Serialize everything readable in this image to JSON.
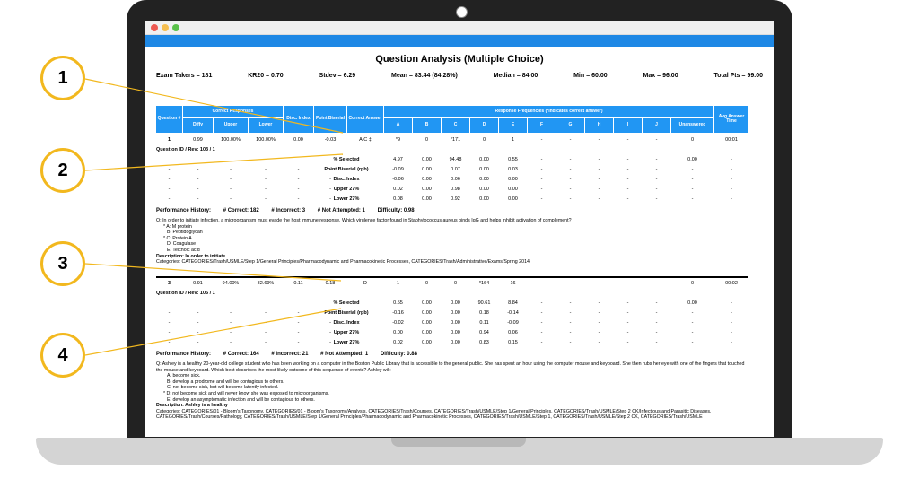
{
  "report": {
    "title": "Question Analysis (Multiple Choice)",
    "stats": {
      "exam_takers": "Exam Takers = 181",
      "kr20": "KR20 = 0.70",
      "stdev": "Stdev = 6.29",
      "mean": "Mean = 83.44 (84.28%)",
      "median": "Median = 84.00",
      "min": "Min = 60.00",
      "max": "Max = 96.00",
      "total_pts": "Total Pts = 99.00"
    },
    "headers": {
      "question": "Question #",
      "correct_responses": "Correct Responses",
      "diffy": "Diffy",
      "upper": "Upper",
      "lower": "Lower",
      "disc_index": "Disc. Index",
      "point_biserial": "Point Biserial",
      "correct_answer": "Correct Answer",
      "response_freq": "Response Frequencies (*Indicates correct answer)",
      "a": "A",
      "b": "B",
      "c": "C",
      "d": "D",
      "e": "E",
      "f": "F",
      "g": "G",
      "h": "H",
      "i": "I",
      "j": "J",
      "unanswered": "Unanswered",
      "avg_time": "Avg Answer Time"
    },
    "q1": {
      "num": "1",
      "diffy": "0.99",
      "upper": "100.00%",
      "lower": "100.00%",
      "disc": "0.00",
      "pbis": "-0.03",
      "answer": "A,C ‡",
      "freq": [
        "*9",
        "0",
        "*171",
        "0",
        "1",
        "-",
        "-",
        "-",
        "-",
        "-"
      ],
      "unanswered": "0",
      "time": "00:01",
      "id_rev": "Question ID / Rev: 103 / 1",
      "sub_rows": [
        {
          "label": "% Selected",
          "vals": [
            "4.97",
            "0.00",
            "94.48",
            "0.00",
            "0.55",
            "-",
            "-",
            "-",
            "-",
            "-",
            "0.00",
            "-"
          ]
        },
        {
          "label": "Point Biserial (rpb)",
          "vals": [
            "-0.09",
            "0.00",
            "0.07",
            "0.00",
            "0.03",
            "-",
            "-",
            "-",
            "-",
            "-",
            "-",
            "-"
          ]
        },
        {
          "label": "Disc. Index",
          "vals": [
            "-0.06",
            "0.00",
            "0.06",
            "0.00",
            "0.00",
            "-",
            "-",
            "-",
            "-",
            "-",
            "-",
            "-"
          ]
        },
        {
          "label": "Upper 27%",
          "vals": [
            "0.02",
            "0.00",
            "0.98",
            "0.00",
            "0.00",
            "-",
            "-",
            "-",
            "-",
            "-",
            "-",
            "-"
          ]
        },
        {
          "label": "Lower 27%",
          "vals": [
            "0.08",
            "0.00",
            "0.92",
            "0.00",
            "0.00",
            "-",
            "-",
            "-",
            "-",
            "-",
            "-",
            "-"
          ]
        }
      ],
      "performance": "Performance History:",
      "correct": "# Correct: 182",
      "incorrect": "# Incorrect: 3",
      "not_attempted": "# Not Attempted: 1",
      "difficulty": "Difficulty: 0.98",
      "question_text": "Q: In order to initiate infection, a microorganism must evade the host immune response. Which virulence factor found in Staphylococcus aureus binds IgG and helps inhibit activation of complement?",
      "options": [
        "* A: M protein",
        "B: Peptidoglycan",
        "* C: Protein A",
        "D: Coagulase",
        "E: Teichoic acid"
      ],
      "description": "Description: In order to initiate",
      "categories": "Categories: CATEGORIES/Trash/USMLE/Step 1/General Principles/Pharmacodynamic and Pharmacokinetic Processes, CATEGORIES/Trash/Administrative/Exams/Spring 2014"
    },
    "q3": {
      "num": "3",
      "diffy": "0.91",
      "upper": "94.00%",
      "lower": "82.69%",
      "disc": "0.11",
      "pbis": "0.18",
      "answer": "D",
      "freq": [
        "1",
        "0",
        "0",
        "*164",
        "16",
        "-",
        "-",
        "-",
        "-",
        "-"
      ],
      "unanswered": "0",
      "time": "00:02",
      "id_rev": "Question ID / Rev: 105 / 1",
      "sub_rows": [
        {
          "label": "% Selected",
          "vals": [
            "0.55",
            "0.00",
            "0.00",
            "90.61",
            "8.84",
            "-",
            "-",
            "-",
            "-",
            "-",
            "0.00",
            "-"
          ]
        },
        {
          "label": "Point Biserial (rpb)",
          "vals": [
            "-0.16",
            "0.00",
            "0.00",
            "0.18",
            "-0.14",
            "-",
            "-",
            "-",
            "-",
            "-",
            "-",
            "-"
          ]
        },
        {
          "label": "Disc. Index",
          "vals": [
            "-0.02",
            "0.00",
            "0.00",
            "0.11",
            "-0.09",
            "-",
            "-",
            "-",
            "-",
            "-",
            "-",
            "-"
          ]
        },
        {
          "label": "Upper 27%",
          "vals": [
            "0.00",
            "0.00",
            "0.00",
            "0.94",
            "0.06",
            "-",
            "-",
            "-",
            "-",
            "-",
            "-",
            "-"
          ]
        },
        {
          "label": "Lower 27%",
          "vals": [
            "0.02",
            "0.00",
            "0.00",
            "0.83",
            "0.15",
            "-",
            "-",
            "-",
            "-",
            "-",
            "-",
            "-"
          ]
        }
      ],
      "performance": "Performance History:",
      "correct": "# Correct: 164",
      "incorrect": "# Incorrect: 21",
      "not_attempted": "# Not Attempted: 1",
      "difficulty": "Difficulty: 0.88",
      "question_text": "Q: Ashley is a healthy 20-year-old college student who has been working on a computer in the Boston Public Library that is accessible to the general public. She has spent an hour using the computer mouse and keyboard. She then rubs her eye with one of the fingers that touched the mouse and keyboard. Which best describes the most likely outcome of this sequence of events? Ashley will:",
      "options": [
        "A: become sick.",
        "B: develop a prodrome and will be contagious to others.",
        "C: not become sick, but will become latently infected.",
        "* D: not become sick and will never know she was exposed to microorganisms.",
        "E: develop an asymptomatic infection and will be contagious to others."
      ],
      "description": "Description: Ashley is a healthy",
      "categories": "Categories: CATEGORIES/01 - Bloom's Taxonomy, CATEGORIES/01 - Bloom's Taxonomy/Analysis, CATEGORIES/Trash/Courses, CATEGORIES/Trash/USMLE/Step 1/General Principles, CATEGORIES/Trash/USMLE/Step 2 CK/Infectious and Parasitic Diseases, CATEGORIES/Trash/Courses/Pathology, CATEGORIES/Trash/USMLE/Step 1/General Principles/Pharmacodynamic and Pharmacokinetic Processes, CATEGORIES/Trash/USMLE/Step 1, CATEGORIES/Trash/USMLE/Step 2 CK, CATEGORIES/Trash/USMLE"
    }
  },
  "callouts": [
    "1",
    "2",
    "3",
    "4"
  ],
  "colors": {
    "header_blue": "#2196f3",
    "bar_blue": "#1e88e5",
    "callout_ring": "#f2b81e"
  }
}
